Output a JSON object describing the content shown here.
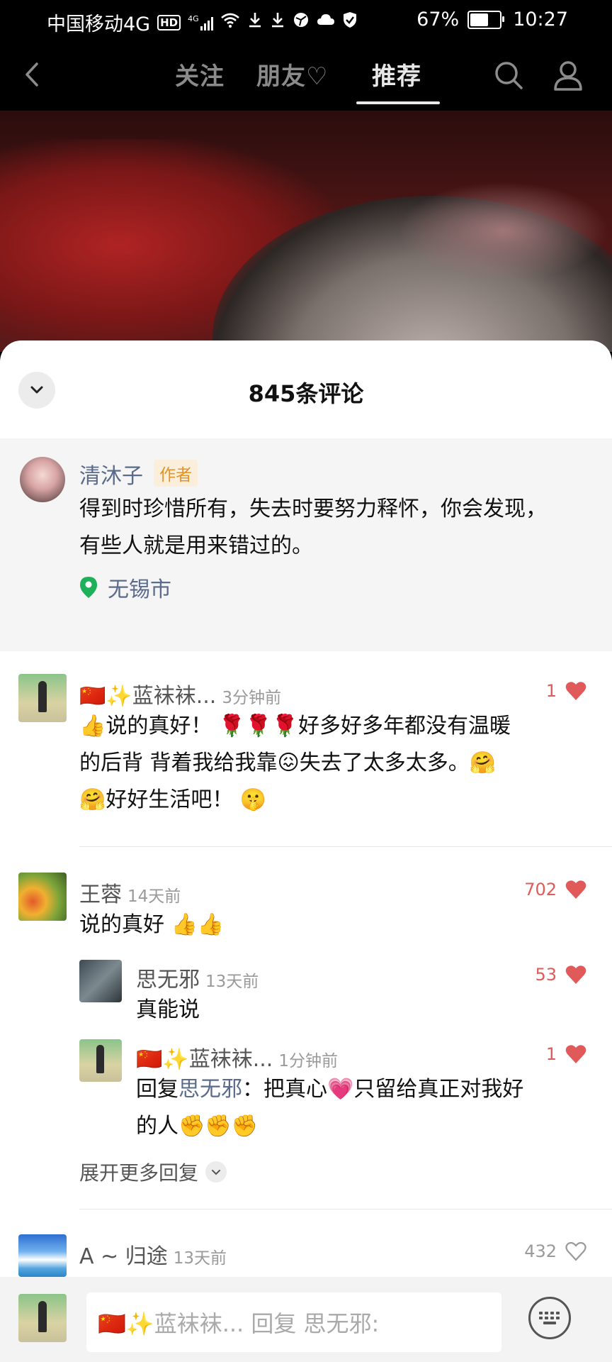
{
  "status_bar": {
    "carrier": "中国移动4G",
    "hd": "HD",
    "signal_type": "4G",
    "battery_percent": "67%",
    "battery_level": 0.67,
    "time": "10:27"
  },
  "top_nav": {
    "tabs": [
      {
        "label": "关注",
        "active": false
      },
      {
        "label": "朋友♡",
        "active": false
      },
      {
        "label": "推荐",
        "active": true
      }
    ]
  },
  "comments_panel": {
    "title": "845条评论",
    "pinned": {
      "username": "清沐子",
      "badge": "作者",
      "line1": "得到时珍惜所有，失去时要努力释怀，你会发现，",
      "line2": "有些人就是用来错过的。",
      "location": "无锡市"
    },
    "comments": [
      {
        "username": "🇨🇳✨蓝袜袜...",
        "time": "3分钟前",
        "likes": "1",
        "liked": true,
        "line1": "👍说的真好！ 🌹🌹🌹好多好多年都没有温暖",
        "line2": "的后背 背着我给我靠😖失去了太多太多。🤗",
        "line3": "🤗好好生活吧！ 🤫"
      },
      {
        "username": "王蓉",
        "time": "14天前",
        "likes": "702",
        "liked": true,
        "text": "说的真好 👍👍",
        "replies": [
          {
            "username": "思无邪",
            "time": "13天前",
            "likes": "53",
            "liked": true,
            "text": "真能说"
          },
          {
            "username": "🇨🇳✨蓝袜袜...",
            "time": "1分钟前",
            "likes": "1",
            "liked": true,
            "reply_prefix": "回复",
            "reply_to": "思无邪",
            "line1": "：把真心💗只留给真正对我好",
            "line2": "的人✊✊✊"
          }
        ],
        "expand_label": "展开更多回复"
      },
      {
        "username": "A ~ 归途",
        "time": "13天前",
        "likes": "432",
        "liked": false
      }
    ]
  },
  "input_bar": {
    "placeholder": "🇨🇳✨蓝袜袜... 回复 思无邪:"
  },
  "colors": {
    "like_red": "#e15a5a",
    "username_blue": "#5a6b8c",
    "author_badge": "#e2932a",
    "location_green": "#1fb15a"
  }
}
